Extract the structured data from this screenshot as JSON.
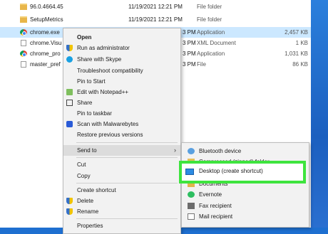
{
  "files": [
    {
      "name": "96.0.4664.45",
      "date": "11/19/2021 12:21 PM",
      "type": "File folder",
      "size": "",
      "icon": "folder-icon"
    },
    {
      "name": "SetupMetrics",
      "date": "11/19/2021 12:21 PM",
      "type": "File folder",
      "size": "",
      "icon": "folder-icon"
    },
    {
      "name": "chrome.exe",
      "date": "3 PM",
      "type": "Application",
      "size": "2,457 KB",
      "icon": "chrome-icon"
    },
    {
      "name": "chrome.Visu",
      "date": "3 PM",
      "type": "XML Document",
      "size": "1 KB",
      "icon": "doc-icon"
    },
    {
      "name": "chrome_pro",
      "date": "3 PM",
      "type": "Application",
      "size": "1,031 KB",
      "icon": "chrome-icon"
    },
    {
      "name": "master_pref",
      "date": "3 PM",
      "type": "File",
      "size": "86 KB",
      "icon": "doc-icon"
    }
  ],
  "context_menu": {
    "open": "Open",
    "run_admin": "Run as administrator",
    "share_skype": "Share with Skype",
    "troubleshoot": "Troubleshoot compatibility",
    "pin_start": "Pin to Start",
    "edit_notepad": "Edit with Notepad++",
    "share": "Share",
    "pin_taskbar": "Pin to taskbar",
    "scan_malwarebytes": "Scan with Malwarebytes",
    "restore_versions": "Restore previous versions",
    "send_to": "Send to",
    "send_to_arrow": "›",
    "cut": "Cut",
    "copy": "Copy",
    "create_shortcut": "Create shortcut",
    "delete": "Delete",
    "rename": "Rename",
    "properties": "Properties"
  },
  "send_to_menu": {
    "bluetooth": "Bluetooth device",
    "compressed": "Compressed (zipped) folder",
    "desktop": "Desktop (create shortcut)",
    "documents": "Documents",
    "evernote": "Evernote",
    "fax": "Fax recipient",
    "mail": "Mail recipient"
  },
  "colors": {
    "highlight_border": "#3ee43e",
    "selected_row": "#cce8ff",
    "desktop_blue": "#1e6fd0"
  }
}
